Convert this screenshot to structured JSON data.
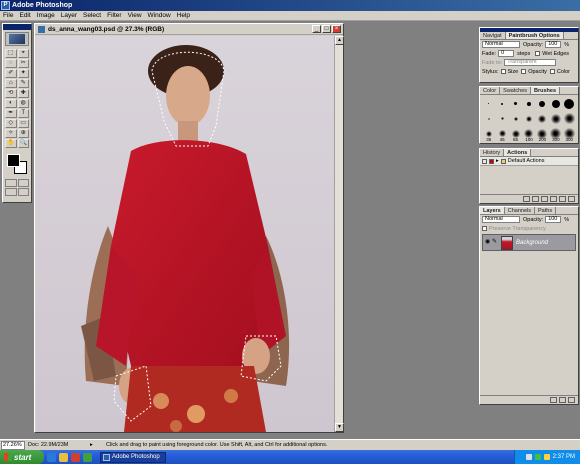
{
  "app": {
    "title": "Adobe Photoshop"
  },
  "menu": [
    "File",
    "Edit",
    "Image",
    "Layer",
    "Select",
    "Filter",
    "View",
    "Window",
    "Help"
  ],
  "toolbox": {
    "tools": [
      "⬚",
      "⌖",
      "◌",
      "✂",
      "✐",
      "✦",
      "⌂",
      "✎",
      "⟲",
      "✚",
      "◐",
      "◍",
      "✒",
      "T",
      "◇",
      "▭",
      "✧",
      "⊕",
      "✋",
      "🔍"
    ]
  },
  "document": {
    "title": "ds_anna_wang03.psd @ 27.3% (RGB)",
    "minimize": "_",
    "maximize": "□",
    "close": "×"
  },
  "options_palette": {
    "tabs": [
      "Navigat",
      "Paintbrush Options"
    ],
    "mode": "Normal",
    "opacity_label": "Opacity:",
    "opacity_value": "100",
    "opacity_unit": "%",
    "fade_label": "Fade:",
    "fade_value": "0",
    "steps_label": "steps",
    "wet_edges": "Wet Edges",
    "fade_to_label": "Fade to:",
    "fade_to_value": "Transparent",
    "stylus_label": "Stylus:",
    "stylus_size": "Size",
    "stylus_opacity": "Opacity",
    "stylus_color": "Color"
  },
  "brushes_palette": {
    "tabs": [
      "Color",
      "Swatches",
      "Brushes"
    ],
    "brushes": [
      {
        "size": 1,
        "soft": false,
        "label": ""
      },
      {
        "size": 2,
        "soft": false,
        "label": ""
      },
      {
        "size": 3,
        "soft": false,
        "label": ""
      },
      {
        "size": 4,
        "soft": false,
        "label": ""
      },
      {
        "size": 6,
        "soft": false,
        "label": ""
      },
      {
        "size": 8,
        "soft": false,
        "label": ""
      },
      {
        "size": 10,
        "soft": false,
        "label": ""
      },
      {
        "size": 2,
        "soft": true,
        "label": ""
      },
      {
        "size": 3,
        "soft": true,
        "label": ""
      },
      {
        "size": 4,
        "soft": true,
        "label": ""
      },
      {
        "size": 6,
        "soft": true,
        "label": ""
      },
      {
        "size": 8,
        "soft": true,
        "label": ""
      },
      {
        "size": 10,
        "soft": true,
        "label": ""
      },
      {
        "size": 11,
        "soft": true,
        "label": ""
      },
      {
        "size": 6,
        "soft": true,
        "label": "35"
      },
      {
        "size": 7,
        "soft": true,
        "label": "45"
      },
      {
        "size": 8,
        "soft": true,
        "label": "65"
      },
      {
        "size": 9,
        "soft": true,
        "label": "100"
      },
      {
        "size": 10,
        "soft": true,
        "label": "200"
      },
      {
        "size": 11,
        "soft": true,
        "label": "300"
      },
      {
        "size": 11,
        "soft": true,
        "label": "300"
      }
    ]
  },
  "actions_palette": {
    "tabs": [
      "History",
      "Actions"
    ],
    "item": "Default Actions"
  },
  "layers_palette": {
    "tabs": [
      "Layers",
      "Channels",
      "Paths"
    ],
    "blend_mode": "Normal",
    "opacity_label": "Opacity:",
    "opacity_value": "100",
    "opacity_unit": "%",
    "preserve": "Preserve Transparency",
    "layer_name": "Background"
  },
  "statusbar": {
    "zoom": "27.26%",
    "doc_size": "Doc: 22.9M/23M",
    "arrow": "▸",
    "hint": "Click and drag to paint using foreground color. Use Shift, Alt, and Ctrl for additional options."
  },
  "taskbar": {
    "start": "start",
    "task": "Adobe Photoshop",
    "clock": "2:37 PM"
  }
}
